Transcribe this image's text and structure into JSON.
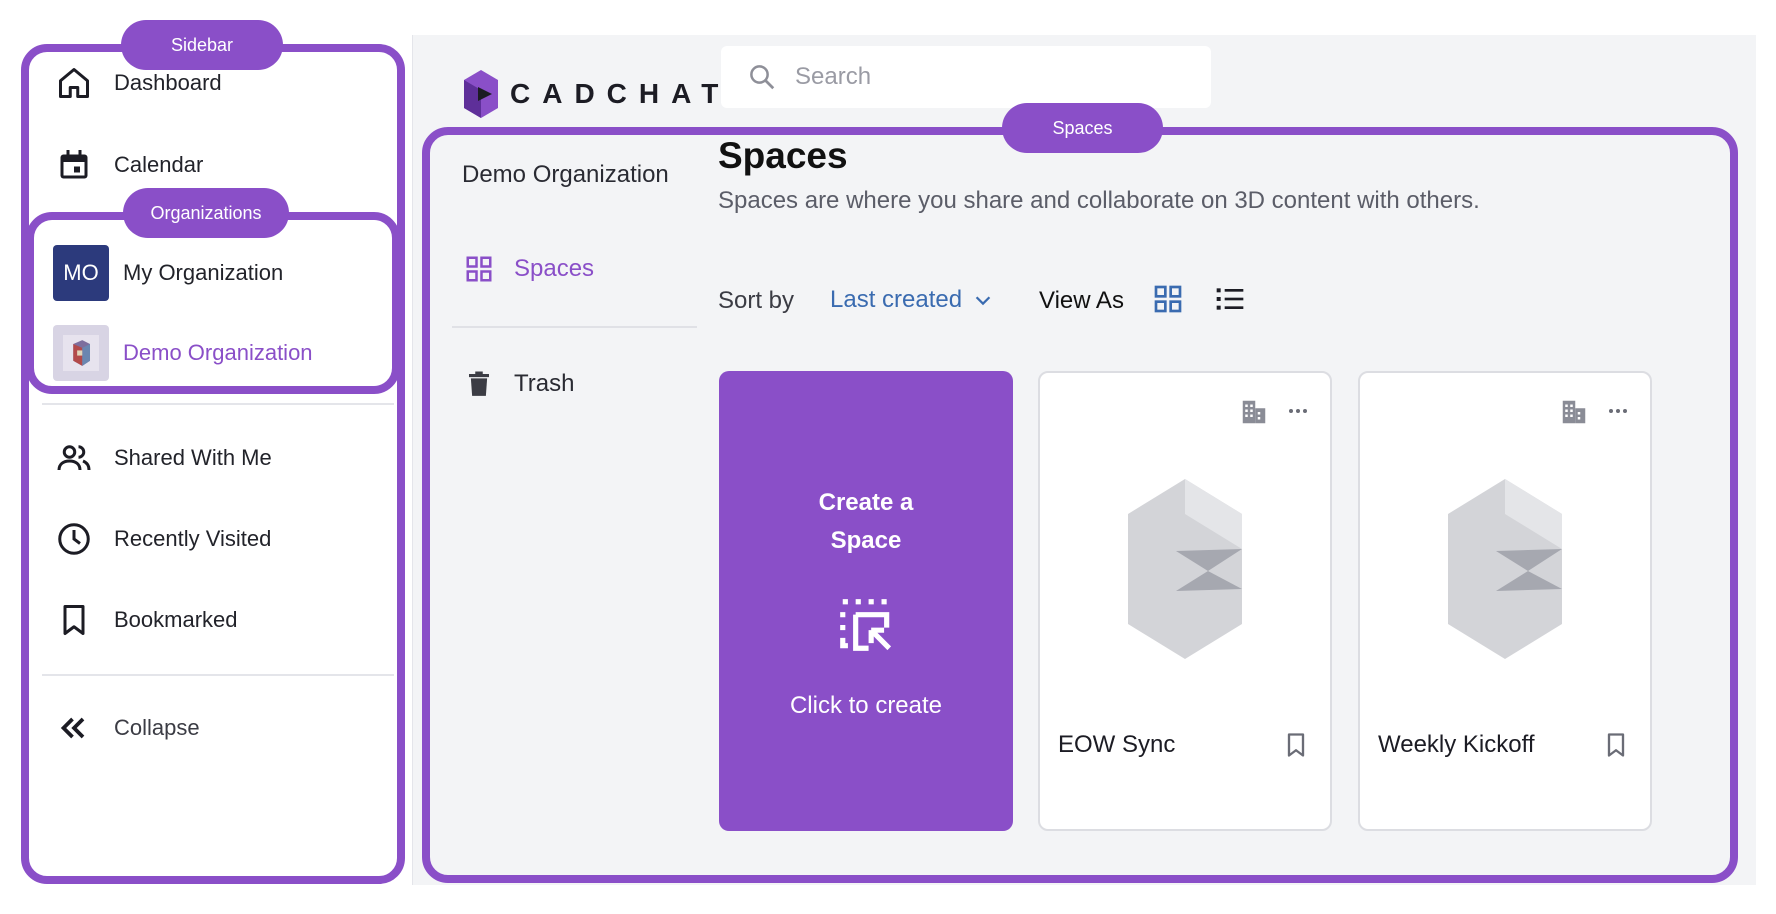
{
  "annotations": {
    "sidebar_label": "Sidebar",
    "organizations_label": "Organizations",
    "spaces_label": "Spaces"
  },
  "sidebar": {
    "dashboard": "Dashboard",
    "calendar": "Calendar",
    "orgs": [
      {
        "initials": "MO",
        "name": "My Organization"
      },
      {
        "name": "Demo Organization"
      }
    ],
    "shared": "Shared With Me",
    "recent": "Recently Visited",
    "bookmarked": "Bookmarked",
    "collapse": "Collapse"
  },
  "brand": {
    "name": "CADCHAT"
  },
  "search": {
    "placeholder": "Search"
  },
  "left_panel": {
    "org_name": "Demo Organization",
    "spaces": "Spaces",
    "trash": "Trash"
  },
  "main": {
    "title": "Spaces",
    "subtitle": "Spaces are where you share and collaborate on 3D content with others.",
    "sort_label": "Sort by",
    "sort_value": "Last created",
    "view_label": "View As"
  },
  "create_card": {
    "title": "Create a Space",
    "action": "Click to create"
  },
  "cards": [
    {
      "title": "EOW Sync"
    },
    {
      "title": "Weekly Kickoff"
    }
  ],
  "colors": {
    "accent": "#8a4fc8",
    "link": "#3a6bb0"
  }
}
